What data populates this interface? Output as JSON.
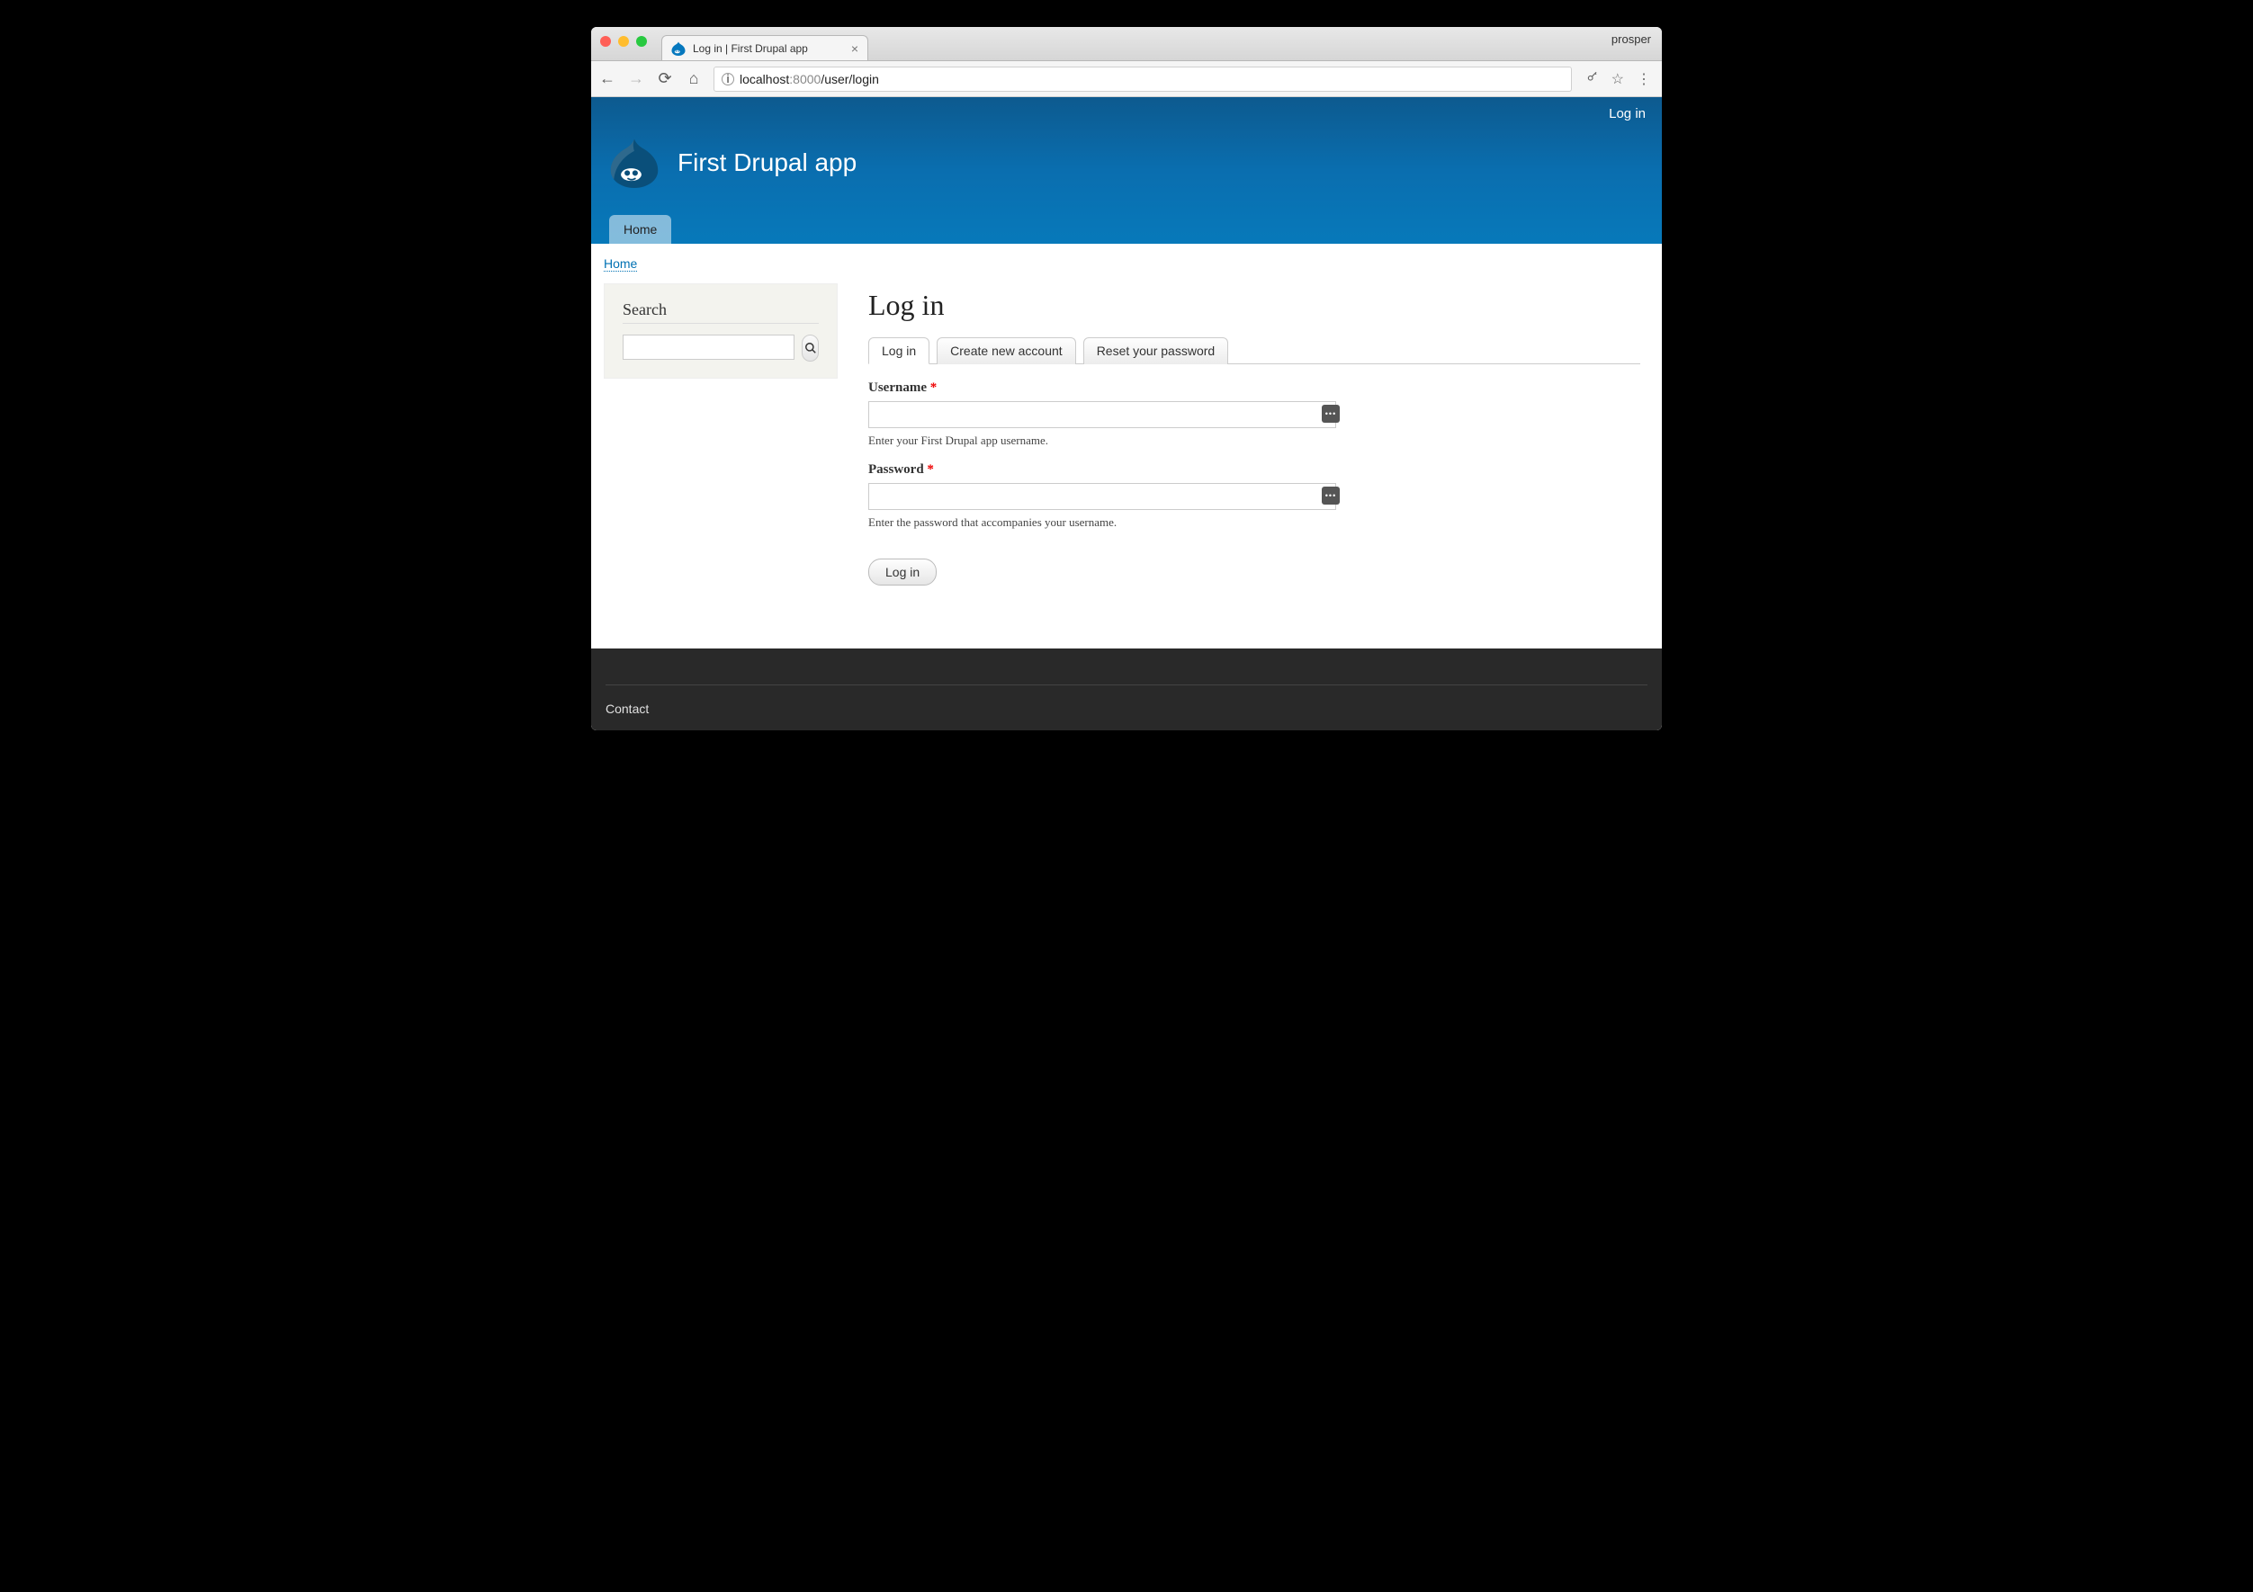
{
  "chrome": {
    "profile_name": "prosper",
    "tab_title": "Log in | First Drupal app",
    "url_host": "localhost",
    "url_port": ":8000",
    "url_path": "/user/login"
  },
  "header": {
    "login_link": "Log in",
    "site_name": "First Drupal app",
    "menu": {
      "home": "Home"
    }
  },
  "breadcrumb": {
    "home": "Home"
  },
  "sidebar": {
    "search_heading": "Search"
  },
  "main": {
    "page_title": "Log in",
    "tabs": {
      "login": "Log in",
      "create": "Create new account",
      "reset": "Reset your password"
    },
    "form": {
      "username_label": "Username",
      "username_desc": "Enter your First Drupal app username.",
      "password_label": "Password",
      "password_desc": "Enter the password that accompanies your username.",
      "required_mark": "*",
      "submit_label": "Log in"
    }
  },
  "footer": {
    "contact": "Contact"
  }
}
